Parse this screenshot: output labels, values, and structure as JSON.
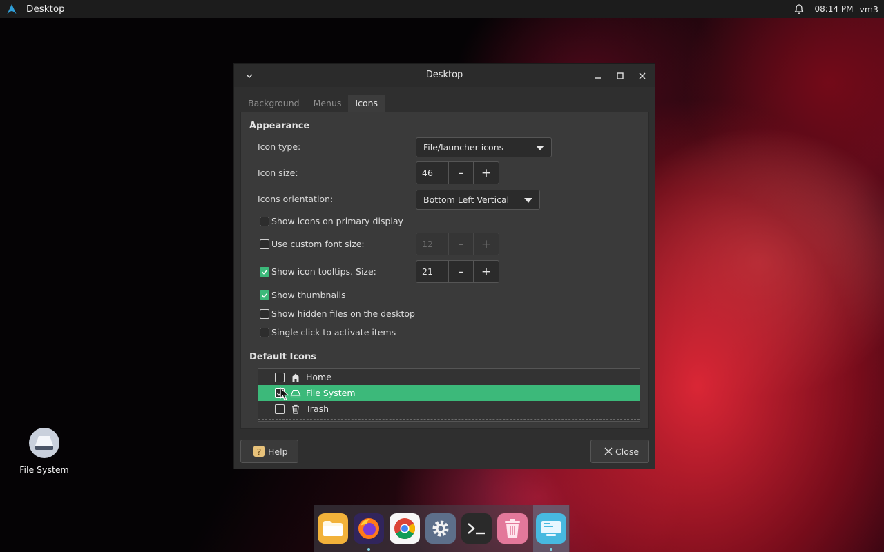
{
  "topbar": {
    "title": "Desktop",
    "time": "08:14 PM",
    "user": "vm3",
    "icons": [
      "arch-logo-icon",
      "bell-icon"
    ]
  },
  "desktop_icons": [
    {
      "label": "File System",
      "icon": "drive-icon"
    }
  ],
  "window": {
    "title": "Desktop",
    "tabs": [
      {
        "label": "Background",
        "active": false
      },
      {
        "label": "Menus",
        "active": false
      },
      {
        "label": "Icons",
        "active": true
      }
    ],
    "appearance": {
      "section_title": "Appearance",
      "icon_type_label": "Icon type:",
      "icon_type_value": "File/launcher icons",
      "icon_size_label": "Icon size:",
      "icon_size_value": "46",
      "orientation_label": "Icons orientation:",
      "orientation_value": "Bottom Left Vertical",
      "show_primary_label": "Show icons on primary display",
      "show_primary_checked": false,
      "custom_font_label": "Use custom font size:",
      "custom_font_checked": false,
      "custom_font_value": "12",
      "tooltips_label": "Show icon tooltips. Size:",
      "tooltips_checked": true,
      "tooltips_value": "21",
      "thumbnails_label": "Show thumbnails",
      "thumbnails_checked": true,
      "hidden_files_label": "Show hidden files on the desktop",
      "hidden_files_checked": false,
      "single_click_label": "Single click to activate items",
      "single_click_checked": false
    },
    "default_icons": {
      "section_title": "Default Icons",
      "items": [
        {
          "label": "Home",
          "checked": false,
          "selected": false,
          "icon": "home-icon"
        },
        {
          "label": "File System",
          "checked": true,
          "selected": true,
          "icon": "drive-icon"
        },
        {
          "label": "Trash",
          "checked": false,
          "selected": false,
          "icon": "trash-icon"
        }
      ]
    },
    "buttons": {
      "help": "Help",
      "close": "Close"
    }
  },
  "dock": {
    "apps": [
      "files",
      "firefox",
      "chrome",
      "settings",
      "terminal",
      "trash",
      "desktop-settings"
    ],
    "active": "desktop-settings"
  },
  "colors": {
    "accent": "#3cb97a",
    "window_bg": "#2f2f2f",
    "panel_bg": "#3a3a3a",
    "topbar_bg": "#1c1c1c"
  }
}
